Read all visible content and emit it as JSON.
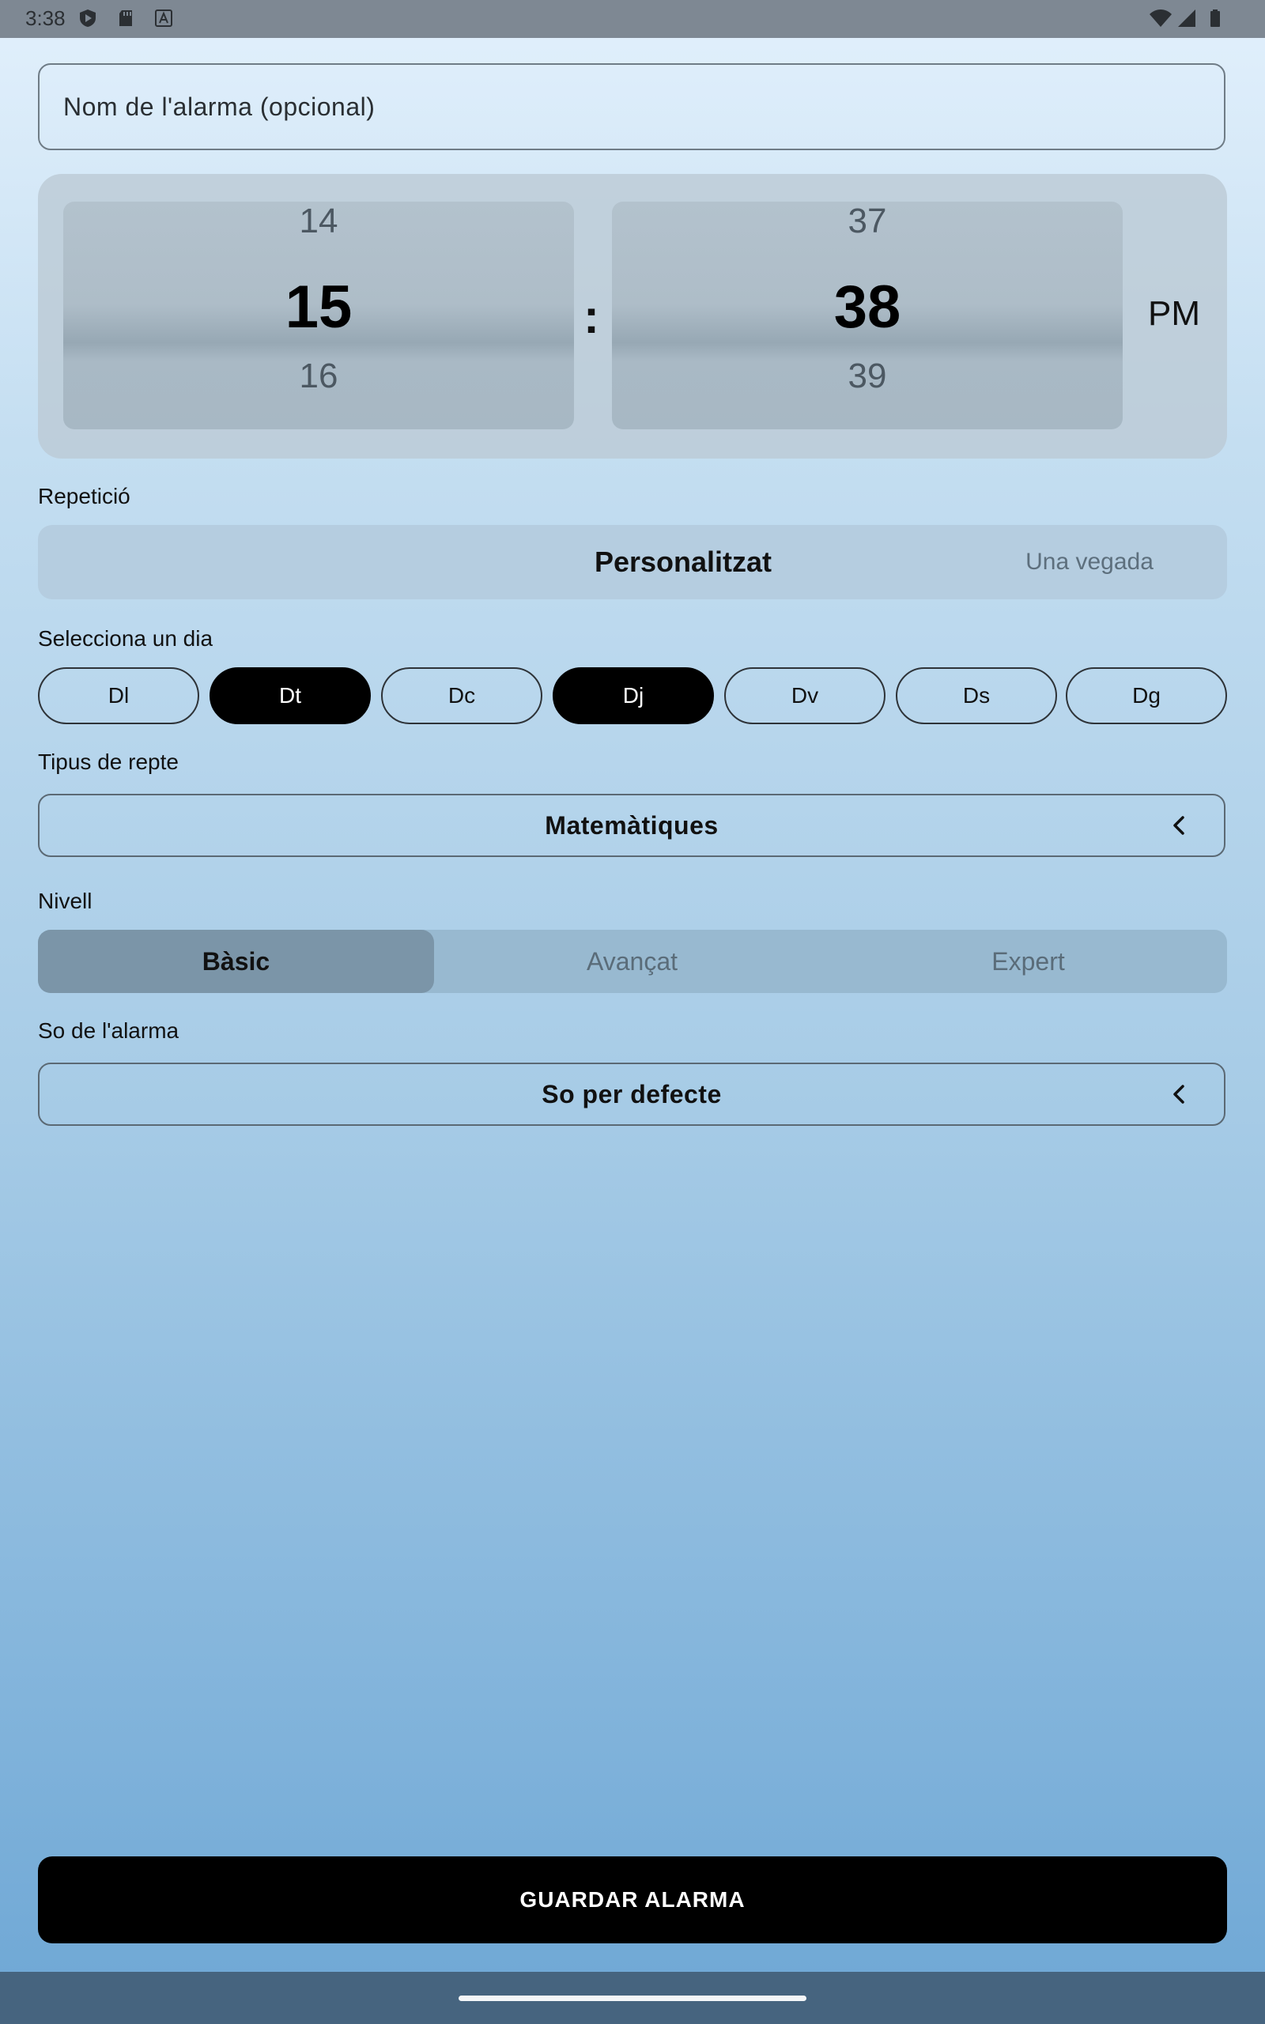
{
  "status_bar": {
    "time": "3:38",
    "left_icons": [
      "shield-play-icon",
      "sd-card-icon",
      "font-a-icon"
    ],
    "right_icons": [
      "wifi-icon",
      "signal-icon",
      "battery-icon"
    ]
  },
  "alarm_name": {
    "placeholder": "Nom de l'alarma (opcional)",
    "value": ""
  },
  "time_picker": {
    "hours": {
      "prev": "14",
      "selected": "15",
      "next": "16"
    },
    "separator": ":",
    "minutes": {
      "prev": "37",
      "selected": "38",
      "next": "39"
    },
    "period": "PM"
  },
  "repetition": {
    "label": "Repetició",
    "options": [
      "Personalitzat",
      "Una vegada"
    ],
    "selected": "Personalitzat"
  },
  "day_selector": {
    "label": "Selecciona un dia",
    "days": [
      {
        "label": "Dl",
        "selected": false
      },
      {
        "label": "Dt",
        "selected": true
      },
      {
        "label": "Dc",
        "selected": false
      },
      {
        "label": "Dj",
        "selected": true
      },
      {
        "label": "Dv",
        "selected": false
      },
      {
        "label": "Ds",
        "selected": false
      },
      {
        "label": "Dg",
        "selected": false
      }
    ]
  },
  "challenge_type": {
    "label": "Tipus de repte",
    "value": "Matemàtiques",
    "icon": "chevron-left-icon"
  },
  "level": {
    "label": "Nivell",
    "options": [
      "Bàsic",
      "Avançat",
      "Expert"
    ],
    "selected": "Bàsic"
  },
  "alarm_sound": {
    "label": "So de l'alarma",
    "value": "So per defecte",
    "icon": "chevron-left-icon"
  },
  "save_button": {
    "label": "GUARDAR ALARMA"
  },
  "colors": {
    "accent": "#000000",
    "background_top": "#e2f0fc",
    "background_bottom": "#6ea7d5",
    "status_bar": "#7e8893",
    "nav_bar": "#46647f"
  }
}
